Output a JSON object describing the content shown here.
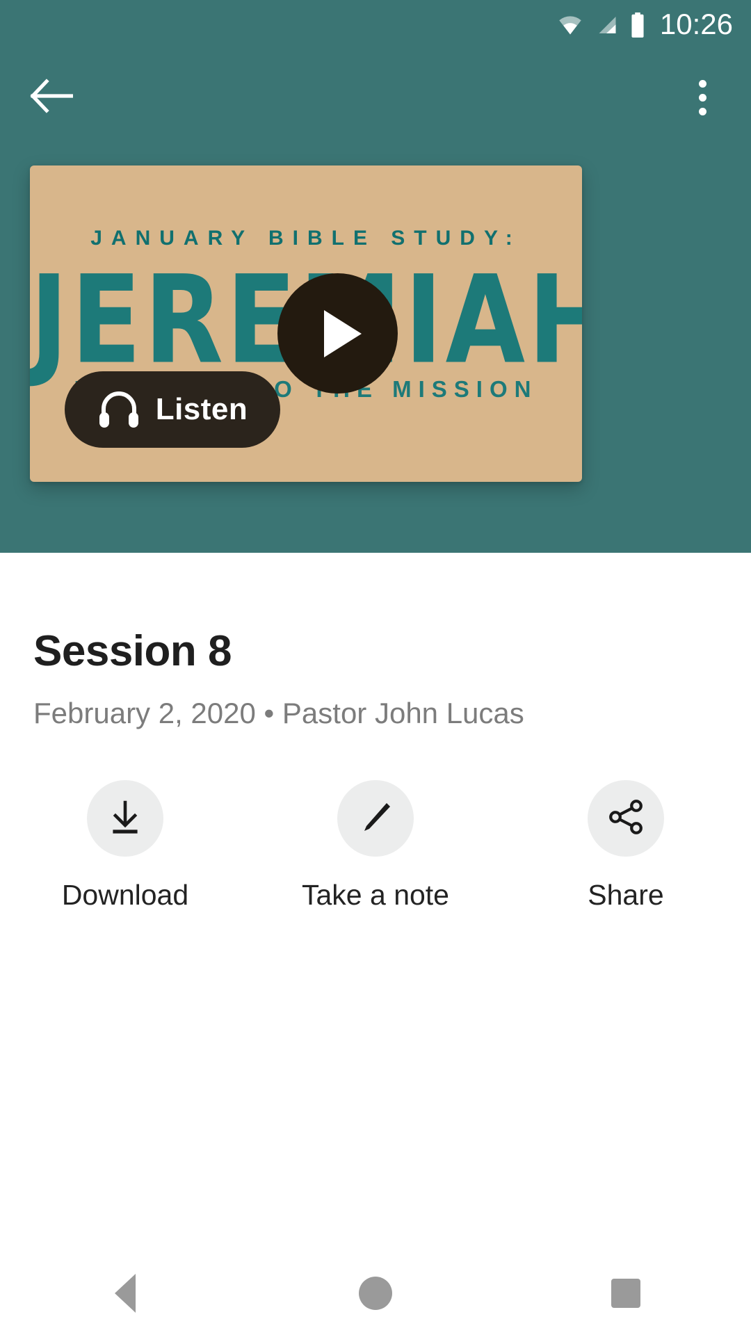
{
  "status_bar": {
    "time": "10:26",
    "icons": [
      "wifi-icon",
      "cellular-signal-icon",
      "battery-icon"
    ]
  },
  "app_bar": {
    "back_icon": "arrow-back-icon",
    "overflow_icon": "more-vertical-icon"
  },
  "hero": {
    "kicker": "JANUARY BIBLE STUDY:",
    "title": "JEREMIAH",
    "subtitle": "FAITHFUL TO THE MISSION",
    "play_icon": "play-icon",
    "listen_label": "Listen",
    "listen_icon": "headphones-icon",
    "colors": {
      "card_background": "#d8b68b",
      "artwork_teal": "#1d7a79",
      "header_teal": "#3b7574",
      "pill_background": "#2b241c",
      "play_overlay": "#231a0f"
    }
  },
  "detail": {
    "title": "Session 8",
    "meta": "February 2, 2020 • Pastor John Lucas"
  },
  "actions": [
    {
      "label": "Download",
      "icon": "download-icon"
    },
    {
      "label": "Take a note",
      "icon": "pencil-icon"
    },
    {
      "label": "Share",
      "icon": "share-icon"
    }
  ],
  "nav_bar": {
    "back": "nav-back-icon",
    "home": "nav-home-icon",
    "recents": "nav-recents-icon"
  }
}
